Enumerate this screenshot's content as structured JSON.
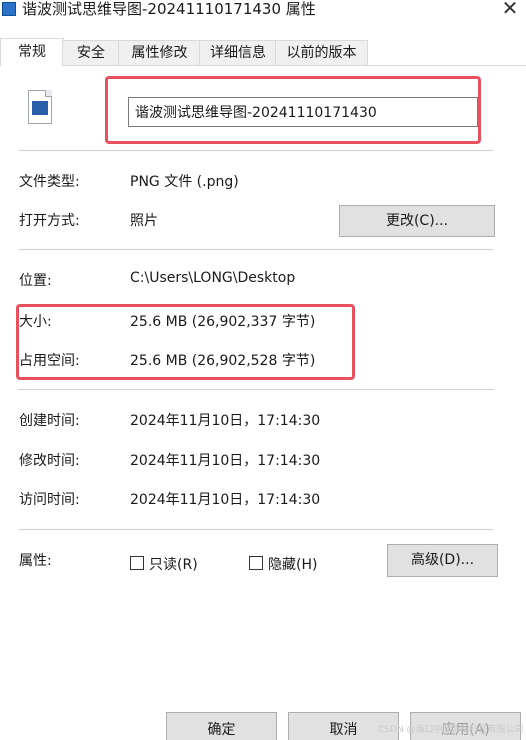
{
  "window": {
    "title": "谐波测试思维导图-20241110171430 属性",
    "close_label": "✕"
  },
  "tabs": [
    {
      "label": "常规"
    },
    {
      "label": "安全"
    },
    {
      "label": "属性修改"
    },
    {
      "label": "详细信息"
    },
    {
      "label": "以前的版本"
    }
  ],
  "file": {
    "name": "谐波测试思维导图-20241110171430",
    "icon": "png-image-file-icon"
  },
  "info": {
    "type_label": "文件类型:",
    "type_value": "PNG 文件 (.png)",
    "open_label": "打开方式:",
    "open_value": "照片",
    "change_button": "更改(C)...",
    "location_label": "位置:",
    "location_value": "C:\\Users\\LONG\\Desktop",
    "size_label": "大小:",
    "size_value": "25.6 MB (26,902,337 字节)",
    "disk_label": "占用空间:",
    "disk_value": "25.6 MB (26,902,528 字节)",
    "created_label": "创建时间:",
    "created_value": "2024年11月10日，17:14:30",
    "modified_label": "修改时间:",
    "modified_value": "2024年11月10日，17:14:30",
    "accessed_label": "访问时间:",
    "accessed_value": "2024年11月10日，17:14:30"
  },
  "attributes": {
    "label": "属性:",
    "readonly_label": "只读(R)",
    "hidden_label": "隐藏(H)",
    "advanced_button": "高级(D)..."
  },
  "footer": {
    "ok_button": "确定",
    "cancel_button": "取消",
    "apply_button": "应用(A)",
    "watermark": "CSDN @海口中际智能科技有限公司"
  },
  "colors": {
    "highlight": "#e8505e",
    "file_icon": "#2b5ea8"
  }
}
